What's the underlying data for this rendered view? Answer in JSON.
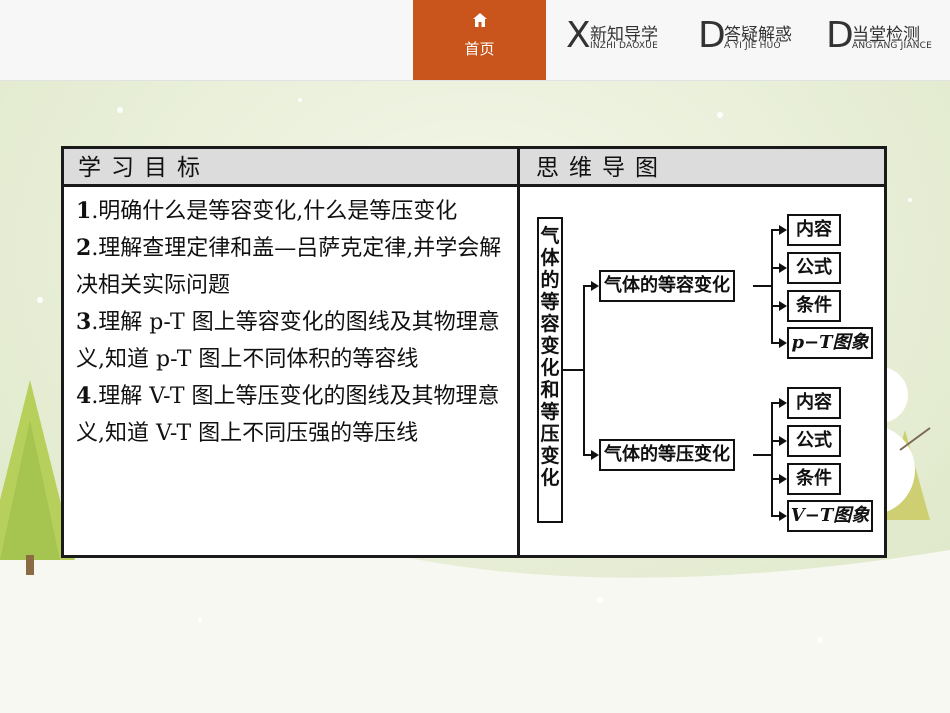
{
  "nav": {
    "home": {
      "icon": "home-icon",
      "label": "首页",
      "color": "#c9541c"
    },
    "items": [
      {
        "big": "X",
        "cn": "新知导学",
        "en": "INZHI DAOXUE"
      },
      {
        "big": "D",
        "cn": "答疑解惑",
        "en": "A YI JIE HUO"
      },
      {
        "big": "D",
        "cn": "当堂检测",
        "en": "ANGTANG JIANCE"
      }
    ]
  },
  "table": {
    "left_header": "学习目标",
    "right_header": "思维导图",
    "goals": [
      {
        "num": "1",
        "text": ".明确什么是等容变化,什么是等压变化"
      },
      {
        "num": "2",
        "text": ".理解查理定律和盖—吕萨克定律,并学会解决相关实际问题"
      },
      {
        "num": "3",
        "text": ".理解 p-T 图上等容变化的图线及其物理意义,知道 p-T 图上不同体积的等容线"
      },
      {
        "num": "4",
        "text": ".理解 V-T 图上等压变化的图线及其物理意义,知道 V-T 图上不同压强的等压线"
      }
    ]
  },
  "mindmap": {
    "root": "气体的等容变化和等压变化",
    "branches": [
      {
        "label": "气体的等容变化",
        "leaves": [
          "内容",
          "公式",
          "条件",
          "p−T图象"
        ]
      },
      {
        "label": "气体的等压变化",
        "leaves": [
          "内容",
          "公式",
          "条件",
          "V−T图象"
        ]
      }
    ]
  }
}
